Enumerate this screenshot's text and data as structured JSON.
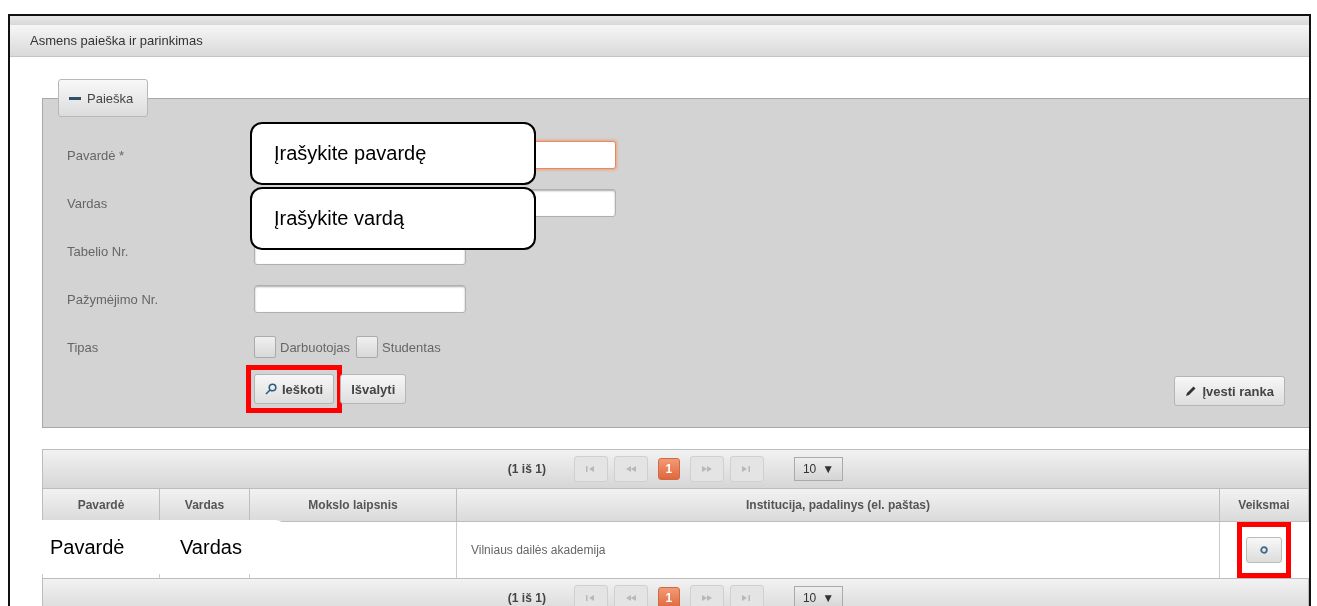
{
  "window": {
    "title": "Asmens paieška ir parinkimas"
  },
  "search_panel": {
    "legend": "Paieška",
    "expanded": true,
    "fields": [
      {
        "label": "Pavardė *",
        "kind": "text",
        "focused": true
      },
      {
        "label": "Vardas",
        "kind": "text",
        "focused": false
      },
      {
        "label": "Tabelio Nr.",
        "kind": "text",
        "focused": false
      },
      {
        "label": "Pažymėjimo Nr.",
        "kind": "text",
        "focused": false
      },
      {
        "label": "Tipas",
        "kind": "checkboxes",
        "options": [
          {
            "label": "Darbuotojas",
            "checked": false
          },
          {
            "label": "Studentas",
            "checked": false
          }
        ]
      }
    ],
    "buttons": [
      {
        "label": "Ieškoti",
        "kind": "search",
        "highlighted": true
      },
      {
        "label": "Išvalyti",
        "kind": "plain",
        "highlighted": false
      }
    ],
    "manual_button": {
      "label": "Įvesti ranka",
      "kind": "edit"
    }
  },
  "results": {
    "paginator_top": {
      "summary": "(1 iš 1)",
      "nav_disabled": true,
      "pages": [
        {
          "label": "1",
          "selected": true
        }
      ],
      "rows_per_page": "10",
      "caret": "▼"
    },
    "columns": [
      "Pavardė",
      "Vardas",
      "Mokslo laipsnis",
      "Institucija, padalinys (el. paštas)",
      "Veiksmai"
    ],
    "rows": [
      {
        "institution": "Vilniaus dailės akademija",
        "action_highlighted": true
      }
    ],
    "paginator_bottom": {
      "summary": "(1 iš 1)",
      "nav_disabled": true,
      "pages": [
        {
          "label": "1",
          "selected": true
        }
      ],
      "rows_per_page": "10",
      "caret": "▼"
    }
  },
  "annotations": {
    "callouts": [
      "Įrašykite pavardę",
      "Įrašykite vardą"
    ],
    "cell_labels": [
      "Pavardė",
      "Vardas"
    ]
  }
}
